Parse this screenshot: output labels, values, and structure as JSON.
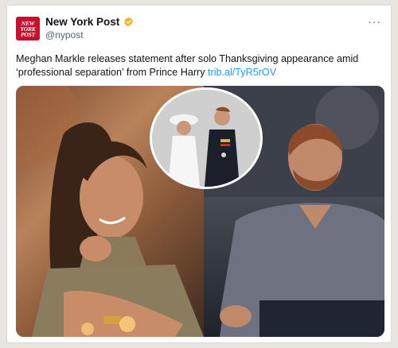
{
  "tweet": {
    "avatar_text_lines": [
      "NEW",
      "YORK",
      "POST"
    ],
    "account_name": "New York Post",
    "handle": "@nypost",
    "more_label": "···",
    "text": "Meghan Markle releases statement after solo Thanksgiving appearance amid ‘professional separation’ from Prince Harry ",
    "link": "trib.al/TyR5rOV"
  },
  "colors": {
    "brand": "#c8102e",
    "verified": "#f0b429",
    "link": "#1d9bf0"
  },
  "icons": {
    "verified": "verified-badge-icon",
    "more": "more-options-icon"
  }
}
